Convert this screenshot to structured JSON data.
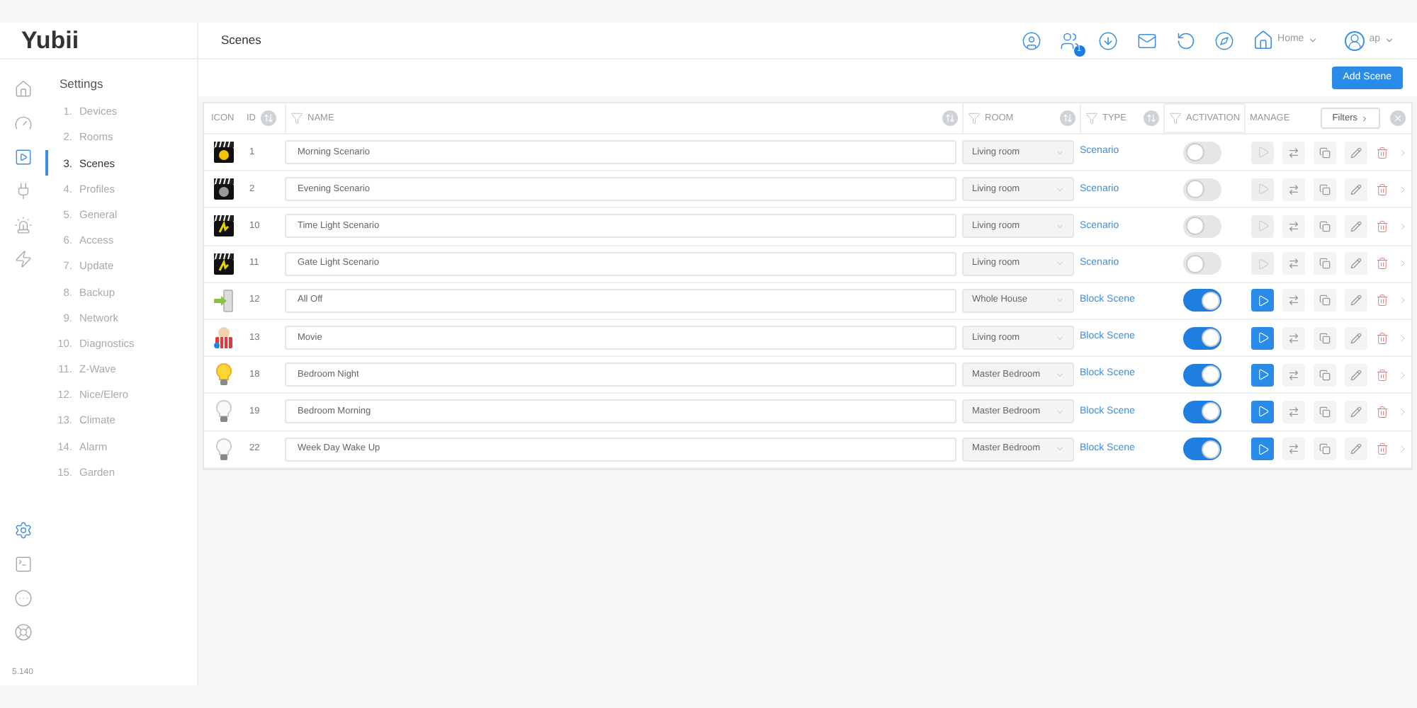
{
  "app": {
    "logo": "Yubii",
    "version": "5.140"
  },
  "header": {
    "title": "Scenes",
    "notification_count": "1",
    "home": "Home",
    "user": "ap"
  },
  "toolbar": {
    "add_button": "Add Scene"
  },
  "sidebar": {
    "heading": "Settings",
    "items": [
      {
        "number": "1.",
        "label": "Devices",
        "selected": false
      },
      {
        "number": "2.",
        "label": "Rooms",
        "selected": false
      },
      {
        "number": "3.",
        "label": "Scenes",
        "selected": true
      },
      {
        "number": "4.",
        "label": "Profiles",
        "selected": false
      },
      {
        "number": "5.",
        "label": "General",
        "selected": false
      },
      {
        "number": "6.",
        "label": "Access",
        "selected": false
      },
      {
        "number": "7.",
        "label": "Update",
        "selected": false
      },
      {
        "number": "8.",
        "label": "Backup",
        "selected": false
      },
      {
        "number": "9.",
        "label": "Network",
        "selected": false
      },
      {
        "number": "10.",
        "label": "Diagnostics",
        "selected": false
      },
      {
        "number": "11.",
        "label": "Z-Wave",
        "selected": false
      },
      {
        "number": "12.",
        "label": "Nice/Elero",
        "selected": false
      },
      {
        "number": "13.",
        "label": "Climate",
        "selected": false
      },
      {
        "number": "14.",
        "label": "Alarm",
        "selected": false
      },
      {
        "number": "15.",
        "label": "Garden",
        "selected": false
      }
    ]
  },
  "table": {
    "columns": [
      {
        "label": "ICON",
        "kind": "plain"
      },
      {
        "label": "ID",
        "kind": "sortable"
      },
      {
        "label": "NAME",
        "kind": "filterable-sortable"
      },
      {
        "label": "ROOM",
        "kind": "filterable-sortable"
      },
      {
        "label": "TYPE",
        "kind": "filterable-sortable"
      },
      {
        "label": "ACTIVATION",
        "kind": "filterable"
      },
      {
        "label": "MANAGE",
        "kind": "plain"
      }
    ],
    "filters_button": "Filters",
    "rows": [
      {
        "kind": "clapper-sun",
        "id": "1",
        "name": "Morning Scenario",
        "room": "Living room",
        "type": "Scenario",
        "active": false
      },
      {
        "kind": "clapper-moon",
        "id": "2",
        "name": "Evening Scenario",
        "room": "Living room",
        "type": "Scenario",
        "active": false
      },
      {
        "kind": "clapper-light",
        "id": "10",
        "name": "Time Light Scenario",
        "room": "Living room",
        "type": "Scenario",
        "active": false
      },
      {
        "kind": "clapper-light",
        "id": "11",
        "name": "Gate Light Scenario",
        "room": "Living room",
        "type": "Scenario",
        "active": false
      },
      {
        "kind": "exit",
        "id": "12",
        "name": "All Off",
        "room": "Whole House",
        "type": "Block Scene",
        "active": true
      },
      {
        "kind": "cinema",
        "id": "13",
        "name": "Movie",
        "room": "Living room",
        "type": "Block Scene",
        "active": true
      },
      {
        "kind": "bulb-on",
        "id": "18",
        "name": "Bedroom Night",
        "room": "Master Bedroom",
        "type": "Block Scene",
        "active": true
      },
      {
        "kind": "bulb-off",
        "id": "19",
        "name": "Bedroom Morning",
        "room": "Master Bedroom",
        "type": "Block Scene",
        "active": true
      },
      {
        "kind": "bulb-off",
        "id": "22",
        "name": "Week Day Wake Up",
        "room": "Master Bedroom",
        "type": "Block Scene",
        "active": true
      }
    ]
  }
}
